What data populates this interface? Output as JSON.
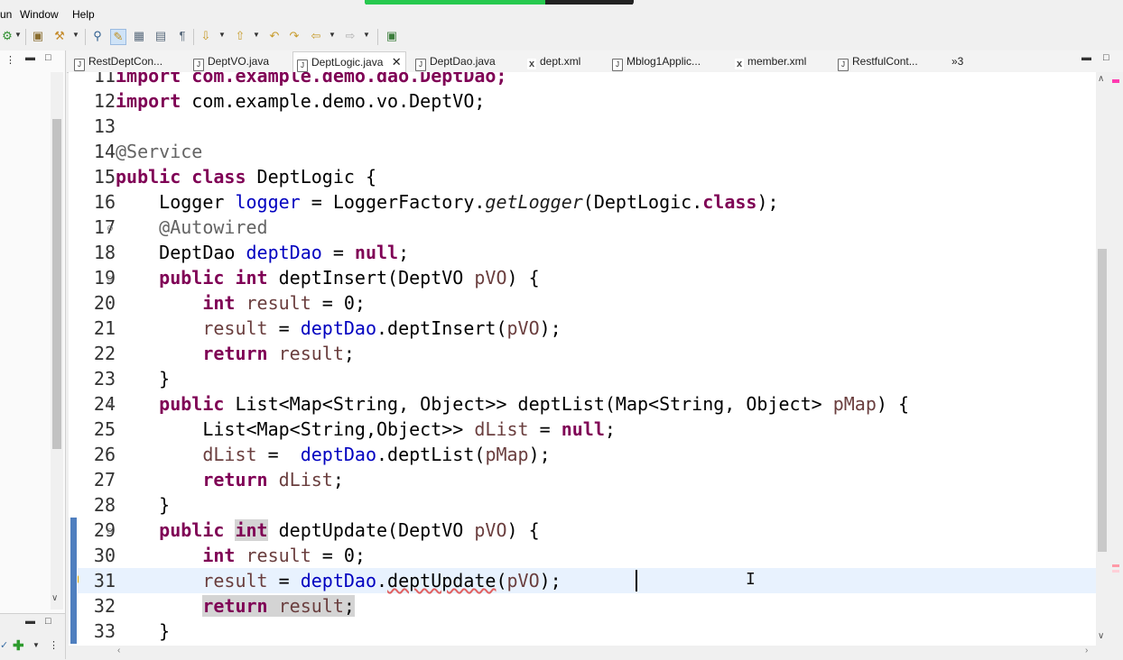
{
  "recording_progress": 0.67,
  "menu": [
    {
      "label": "un"
    },
    {
      "label": "Window"
    },
    {
      "label": "Help"
    }
  ],
  "tabs": [
    {
      "label": "RestDeptCon...",
      "icon": "java-file-icon"
    },
    {
      "label": "DeptVO.java",
      "icon": "java-file-icon"
    },
    {
      "label": "DeptLogic.java",
      "icon": "java-file-icon",
      "active": true
    },
    {
      "label": "DeptDao.java",
      "icon": "java-file-icon"
    },
    {
      "label": "dept.xml",
      "icon": "xml-file-icon"
    },
    {
      "label": "Mblog1Applic...",
      "icon": "java-file-icon"
    },
    {
      "label": "member.xml",
      "icon": "xml-file-icon"
    },
    {
      "label": "RestfulCont...",
      "icon": "java-file-icon"
    },
    {
      "label": "»3",
      "icon": "overflow-icon"
    }
  ],
  "editor": {
    "lines": [
      {
        "num": "11",
        "text": "import com.example.demo.dao.DeptDao;"
      },
      {
        "num": "12",
        "text": "import com.example.demo.vo.DeptVO;"
      },
      {
        "num": "13",
        "text": ""
      },
      {
        "num": "14",
        "text": "@Service"
      },
      {
        "num": "15",
        "text": "public class DeptLogic {"
      },
      {
        "num": "16",
        "text": "    Logger logger = LoggerFactory.getLogger(DeptLogic.class);"
      },
      {
        "num": "17",
        "text": "    @Autowired"
      },
      {
        "num": "18",
        "text": "    DeptDao deptDao = null;"
      },
      {
        "num": "19",
        "text": "    public int deptInsert(DeptVO pVO) {"
      },
      {
        "num": "20",
        "text": "        int result = 0;"
      },
      {
        "num": "21",
        "text": "        result = deptDao.deptInsert(pVO);"
      },
      {
        "num": "22",
        "text": "        return result;"
      },
      {
        "num": "23",
        "text": "    }"
      },
      {
        "num": "24",
        "text": "    public List<Map<String, Object>> deptList(Map<String, Object> pMap) {"
      },
      {
        "num": "25",
        "text": "        List<Map<String,Object>> dList = null;"
      },
      {
        "num": "26",
        "text": "        dList =  deptDao.deptList(pMap);"
      },
      {
        "num": "27",
        "text": "        return dList;"
      },
      {
        "num": "28",
        "text": "    }"
      },
      {
        "num": "29",
        "text": "    public int deptUpdate(DeptVO pVO) {"
      },
      {
        "num": "30",
        "text": "        int result = 0;"
      },
      {
        "num": "31",
        "text": "        result = deptDao.deptUpdate(pVO);"
      },
      {
        "num": "32",
        "text": "        return result;"
      },
      {
        "num": "33",
        "text": "    }"
      }
    ]
  },
  "colors": {
    "keyword": "#7f0055",
    "field": "#0000c0",
    "local_variable": "#6a3e3e",
    "annotation": "#646464",
    "current_line": "#e8f2fe",
    "occurrence_highlight": "#d4d4d4",
    "change_marker": "#4f7fbf"
  }
}
